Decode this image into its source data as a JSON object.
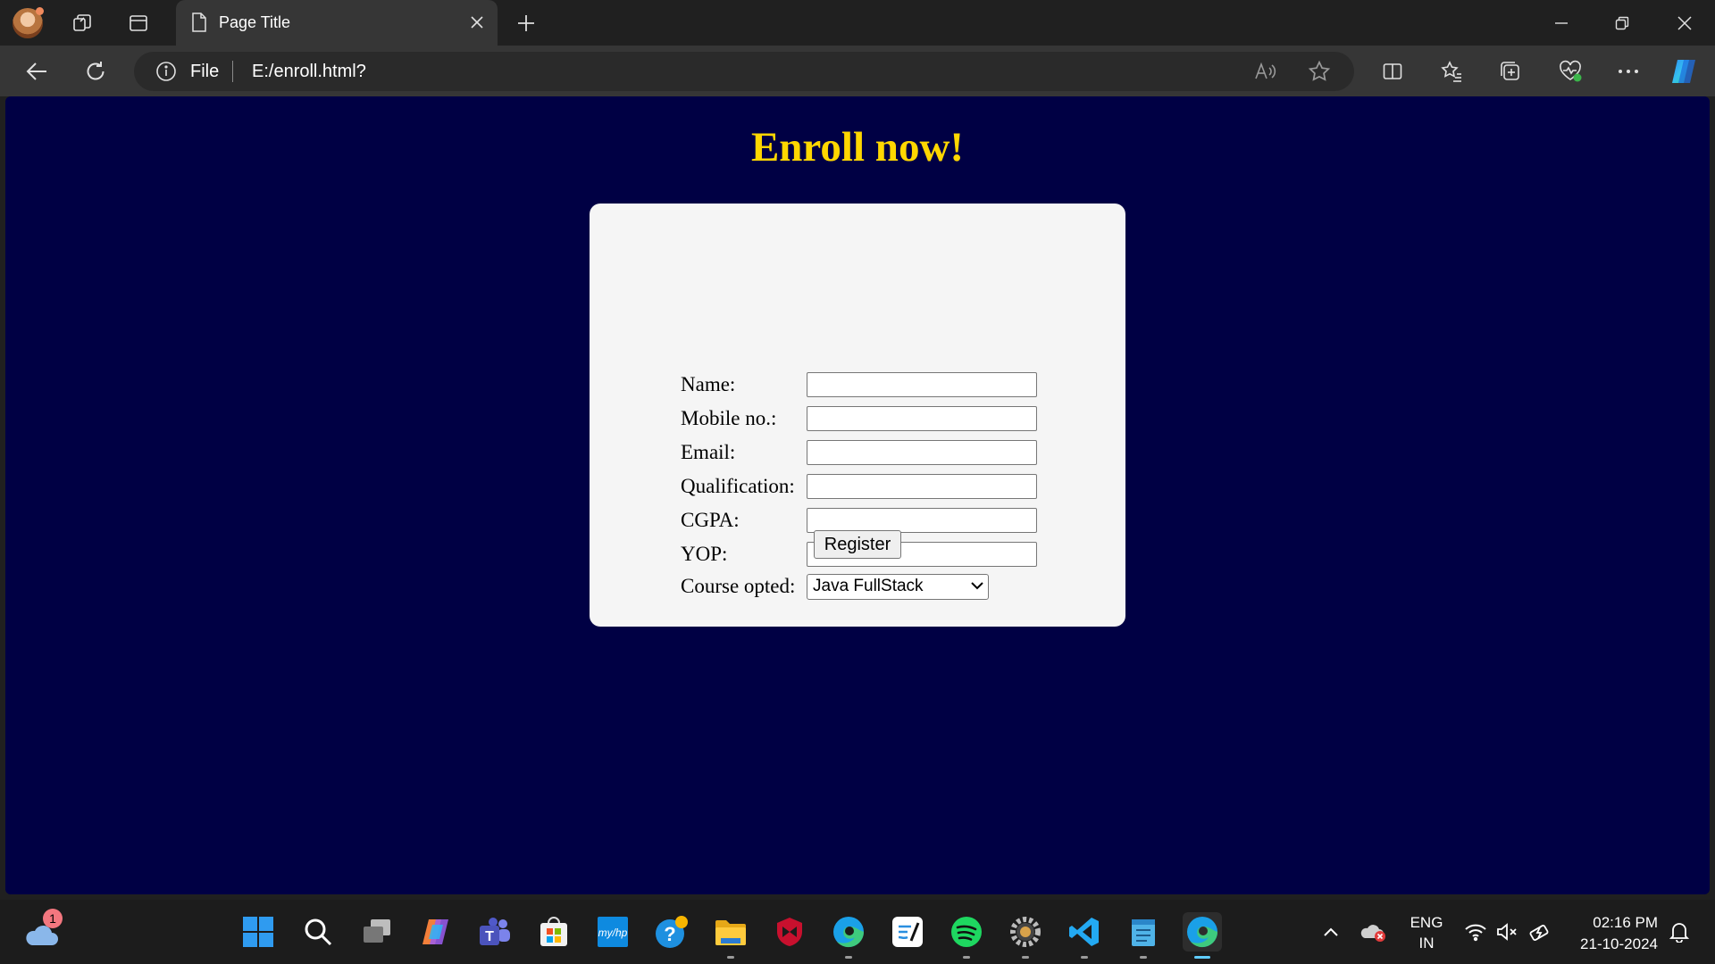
{
  "browser": {
    "tab_title": "Page Title",
    "address_scheme": "File",
    "address_url": "E:/enroll.html?"
  },
  "page": {
    "heading": "Enroll now!",
    "heading_color": "#ffd700",
    "background_color": "#000044",
    "form": {
      "fields": [
        {
          "label": "Name:",
          "value": ""
        },
        {
          "label": "Mobile no.:",
          "value": ""
        },
        {
          "label": "Email:",
          "value": ""
        },
        {
          "label": "Qualification:",
          "value": ""
        },
        {
          "label": "CGPA:",
          "value": ""
        },
        {
          "label": "YOP:",
          "value": ""
        }
      ],
      "course_label": "Course opted:",
      "course_selected": "Java FullStack",
      "submit_label": "Register"
    }
  },
  "taskbar": {
    "weather_badge": "1",
    "apps": [
      "start-icon",
      "search-icon",
      "task-view-icon",
      "copilot-icon",
      "teams-icon",
      "store-icon",
      "myhp-icon",
      "get-help-icon",
      "file-explorer-icon",
      "mcafee-icon",
      "edge-icon",
      "freeform-icon",
      "spotify-icon",
      "settings-app-icon",
      "vscode-icon",
      "notepad-icon",
      "edge-active-icon"
    ],
    "language_top": "ENG",
    "language_bottom": "IN",
    "time": "02:16 PM",
    "date": "21-10-2024"
  }
}
